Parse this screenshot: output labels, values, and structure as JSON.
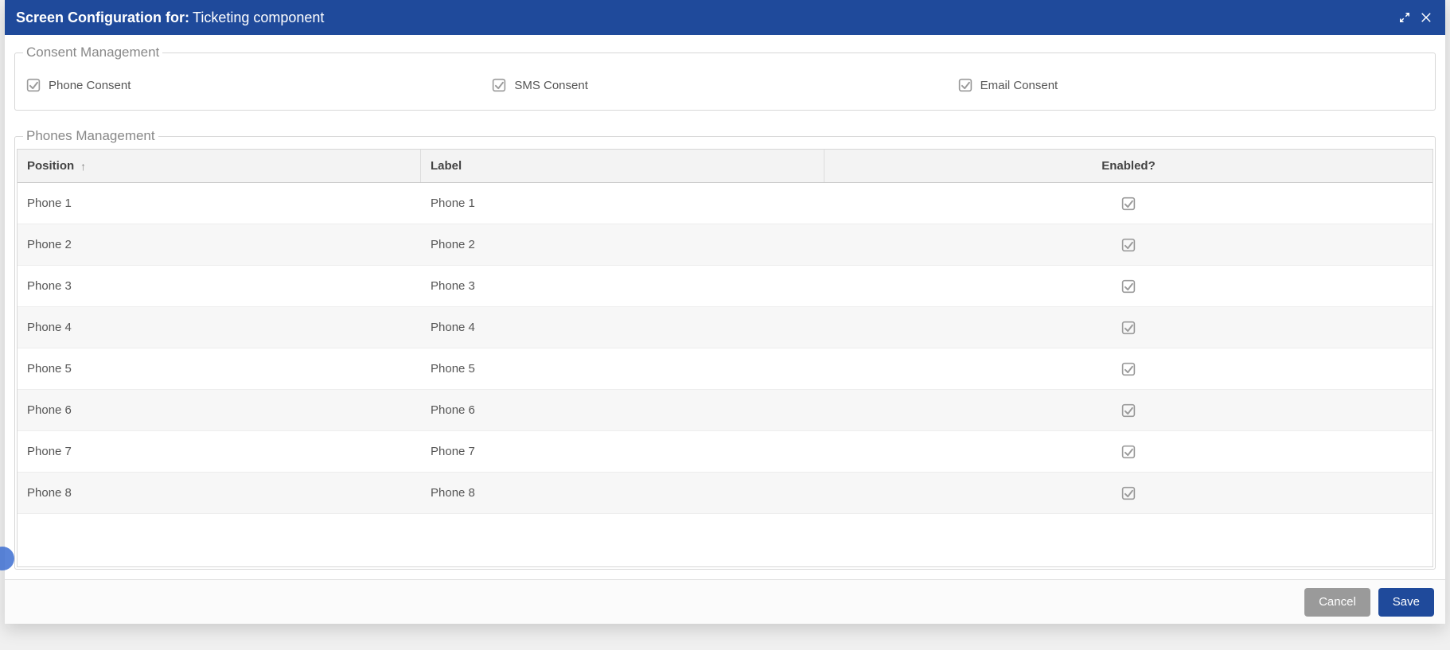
{
  "header": {
    "title_prefix": "Screen Configuration for:",
    "title_suffix": "Ticketing component"
  },
  "consent": {
    "legend": "Consent Management",
    "items": [
      {
        "label": "Phone Consent",
        "checked": true
      },
      {
        "label": "SMS Consent",
        "checked": true
      },
      {
        "label": "Email Consent",
        "checked": true
      }
    ]
  },
  "phones": {
    "legend": "Phones Management",
    "columns": {
      "position": "Position",
      "label": "Label",
      "enabled": "Enabled?"
    },
    "sort": {
      "column": "position",
      "dir": "asc"
    },
    "rows": [
      {
        "position": "Phone 1",
        "label": "Phone 1",
        "enabled": true
      },
      {
        "position": "Phone 2",
        "label": "Phone 2",
        "enabled": true
      },
      {
        "position": "Phone 3",
        "label": "Phone 3",
        "enabled": true
      },
      {
        "position": "Phone 4",
        "label": "Phone 4",
        "enabled": true
      },
      {
        "position": "Phone 5",
        "label": "Phone 5",
        "enabled": true
      },
      {
        "position": "Phone 6",
        "label": "Phone 6",
        "enabled": true
      },
      {
        "position": "Phone 7",
        "label": "Phone 7",
        "enabled": true
      },
      {
        "position": "Phone 8",
        "label": "Phone 8",
        "enabled": true
      }
    ]
  },
  "footer": {
    "cancel": "Cancel",
    "save": "Save"
  }
}
